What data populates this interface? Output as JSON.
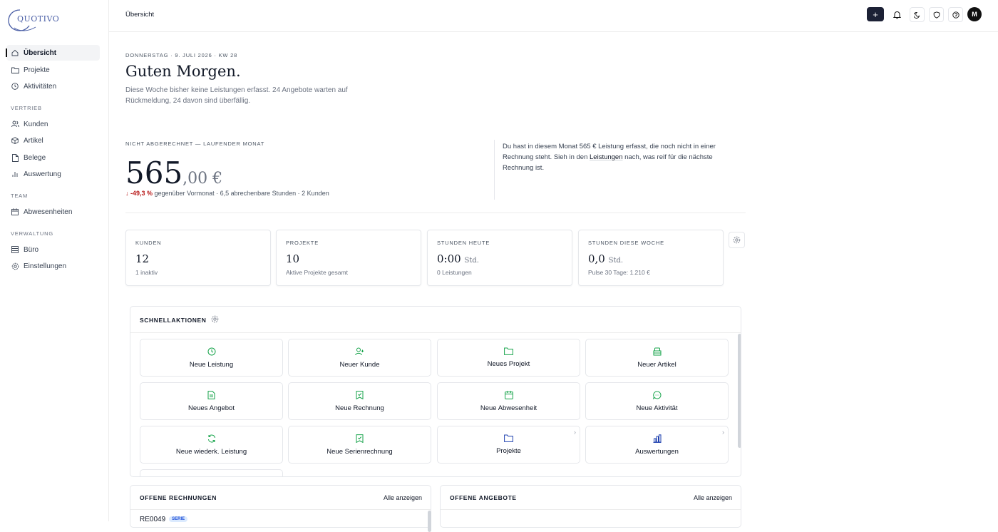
{
  "app": {
    "logo_text": "QUOTIVO"
  },
  "sidebar": {
    "items": [
      {
        "label": "Übersicht",
        "icon": "home-icon",
        "active": true
      },
      {
        "label": "Projekte",
        "icon": "folder-icon"
      },
      {
        "label": "Aktivitäten",
        "icon": "clock-icon"
      }
    ],
    "sections": [
      {
        "title": "VERTRIEB",
        "items": [
          {
            "label": "Kunden",
            "icon": "users-icon"
          },
          {
            "label": "Artikel",
            "icon": "box-icon"
          },
          {
            "label": "Belege",
            "icon": "file-icon"
          },
          {
            "label": "Auswertung",
            "icon": "bar-chart-icon"
          }
        ]
      },
      {
        "title": "TEAM",
        "items": [
          {
            "label": "Abwesenheiten",
            "icon": "calendar-icon"
          }
        ]
      },
      {
        "title": "VERWALTUNG",
        "items": [
          {
            "label": "Büro",
            "icon": "office-icon"
          },
          {
            "label": "Einstellungen",
            "icon": "settings-icon"
          }
        ]
      }
    ]
  },
  "topbar": {
    "breadcrumb": "Übersicht",
    "plus_label": "+",
    "avatar_initial": "M"
  },
  "hero": {
    "dateline": "DONNERSTAG · 9. JULI 2026 · KW 28",
    "greeting": "Guten Morgen.",
    "summary": "Diese Woche bisher keine Leistungen erfasst. 24 Angebote warten auf Rückmeldung, 24 davon sind überfällig."
  },
  "unbilled": {
    "label": "NICHT ABGERECHNET — LAUFENDER MONAT",
    "value_main": "565",
    "value_cents": ",00 €",
    "trend_pct": "↓ -49,3 %",
    "trend_rest": " gegenüber Vormonat · 6,5 abrechenbare Stunden · 2 Kunden",
    "info_pre": "Du hast in diesem Monat 565 € Leistung erfasst, die noch nicht in einer Rechnung steht. Sieh in den ",
    "info_link": "Leistungen",
    "info_post": " nach, was reif für die nächste Rechnung ist."
  },
  "stats": [
    {
      "label": "KUNDEN",
      "value": "12",
      "unit": "",
      "sub": "1 inaktiv"
    },
    {
      "label": "PROJEKTE",
      "value": "10",
      "unit": "",
      "sub": "Aktive Projekte gesamt"
    },
    {
      "label": "STUNDEN HEUTE",
      "value": "0:00",
      "unit": "Std.",
      "sub": "0 Leistungen"
    },
    {
      "label": "STUNDEN DIESE WOCHE",
      "value": "0,0",
      "unit": "Std.",
      "sub": "Pulse 30 Tage: 1.210 €"
    }
  ],
  "quick_actions": {
    "title": "SCHNELLAKTIONEN",
    "items": [
      {
        "label": "Neue Leistung",
        "icon": "clock-icon"
      },
      {
        "label": "Neuer Kunde",
        "icon": "user-plus-icon"
      },
      {
        "label": "Neues Projekt",
        "icon": "folder-icon"
      },
      {
        "label": "Neuer Artikel",
        "icon": "package-icon"
      },
      {
        "label": "Neues Angebot",
        "icon": "document-icon"
      },
      {
        "label": "Neue Rechnung",
        "icon": "receipt-icon"
      },
      {
        "label": "Neue Abwesenheit",
        "icon": "calendar-icon"
      },
      {
        "label": "Neue Aktivität",
        "icon": "chat-icon"
      },
      {
        "label": "Neue wiederk. Leistung",
        "icon": "refresh-icon"
      },
      {
        "label": "Neue Serienrechnung",
        "icon": "receipt-icon"
      },
      {
        "label": "Projekte",
        "icon": "folder-icon",
        "chevron": "›"
      },
      {
        "label": "Auswertungen",
        "icon": "chart-icon",
        "chevron": "›"
      }
    ],
    "accent": "#16a34a",
    "accent_blue": "#1e40af"
  },
  "panels": {
    "invoices": {
      "title": "OFFENE RECHNUNGEN",
      "more": "Alle anzeigen",
      "first_row": "RE0049",
      "badge": "SERIE"
    },
    "offers": {
      "title": "OFFENE ANGEBOTE",
      "more": "Alle anzeigen"
    }
  }
}
